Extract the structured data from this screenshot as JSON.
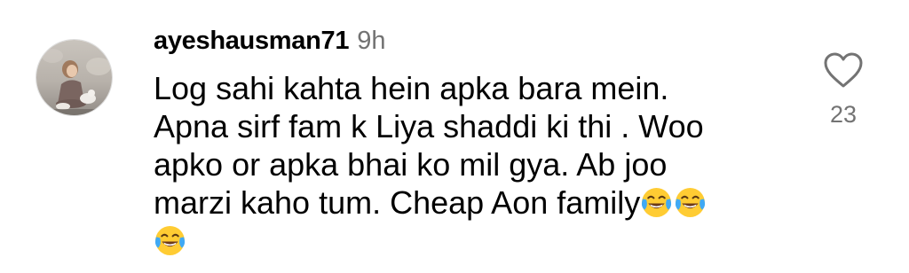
{
  "comment": {
    "username": "ayeshausman71",
    "timestamp": "9h",
    "text_lines": [
      "Log sahi kahta hein apka bara mein.",
      "Apna sirf fam k Liya shaddi ki thi . Woo",
      "apko or apka bhai ko mil gya. Ab joo",
      "marzi kaho tum. Cheap Aon family"
    ],
    "trailing_emojis_line4": [
      "face-with-tears-of-joy",
      "face-with-tears-of-joy"
    ],
    "trailing_emojis_line5": [
      "face-with-tears-of-joy"
    ],
    "like_count": "23",
    "icons": {
      "like": "heart-outline-icon",
      "emoji": "face-with-tears-of-joy-icon"
    },
    "colors": {
      "text": "#000000",
      "secondary_text": "#737373",
      "emoji_face": "#FFCC33",
      "emoji_tears": "#3FA9F5"
    }
  }
}
